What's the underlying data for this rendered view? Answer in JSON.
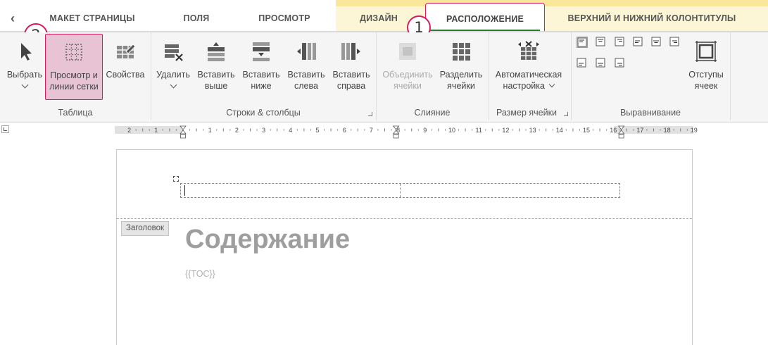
{
  "tabs": [
    {
      "label": "МАКЕТ СТРАНИЦЫ"
    },
    {
      "label": "ПОЛЯ"
    },
    {
      "label": "ПРОСМОТР"
    },
    {
      "label": "ДИЗАЙН"
    },
    {
      "label": "РАСПОЛОЖЕНИЕ",
      "active": true
    },
    {
      "label": "ВЕРХНИЙ И НИЖНИЙ КОЛОНТИТУЛЫ"
    }
  ],
  "badges": {
    "first": "1",
    "second": "2"
  },
  "ribbon": {
    "table": {
      "label": "Таблица",
      "select": "Выбрать",
      "gridlines_line1": "Просмотр и",
      "gridlines_line2": "линии сетки",
      "properties": "Свойства"
    },
    "rows_cols": {
      "label": "Строки & столбцы",
      "delete": "Удалить",
      "insert_above_1": "Вставить",
      "insert_above_2": "выше",
      "insert_below_1": "Вставить",
      "insert_below_2": "ниже",
      "insert_left_1": "Вставить",
      "insert_left_2": "слева",
      "insert_right_1": "Вставить",
      "insert_right_2": "справа"
    },
    "merge": {
      "label": "Слияние",
      "merge_1": "Объединить",
      "merge_2": "ячейки",
      "split_1": "Разделить",
      "split_2": "ячейки"
    },
    "cell_size": {
      "label": "Размер ячейки",
      "autofit_1": "Автоматическая",
      "autofit_2": "настройка"
    },
    "alignment": {
      "label": "Выравнивание",
      "margins_1": "Отступы",
      "margins_2": "ячеек"
    }
  },
  "ruler": {
    "labels": [
      "2",
      "1",
      "1",
      "2",
      "3",
      "4",
      "5",
      "6",
      "7",
      "8",
      "9",
      "10",
      "11",
      "12",
      "13",
      "14",
      "15",
      "16",
      "17",
      "18",
      "19"
    ]
  },
  "document": {
    "header_tag": "Заголовок",
    "title": "Содержание",
    "toc": "{{TOC}}"
  }
}
